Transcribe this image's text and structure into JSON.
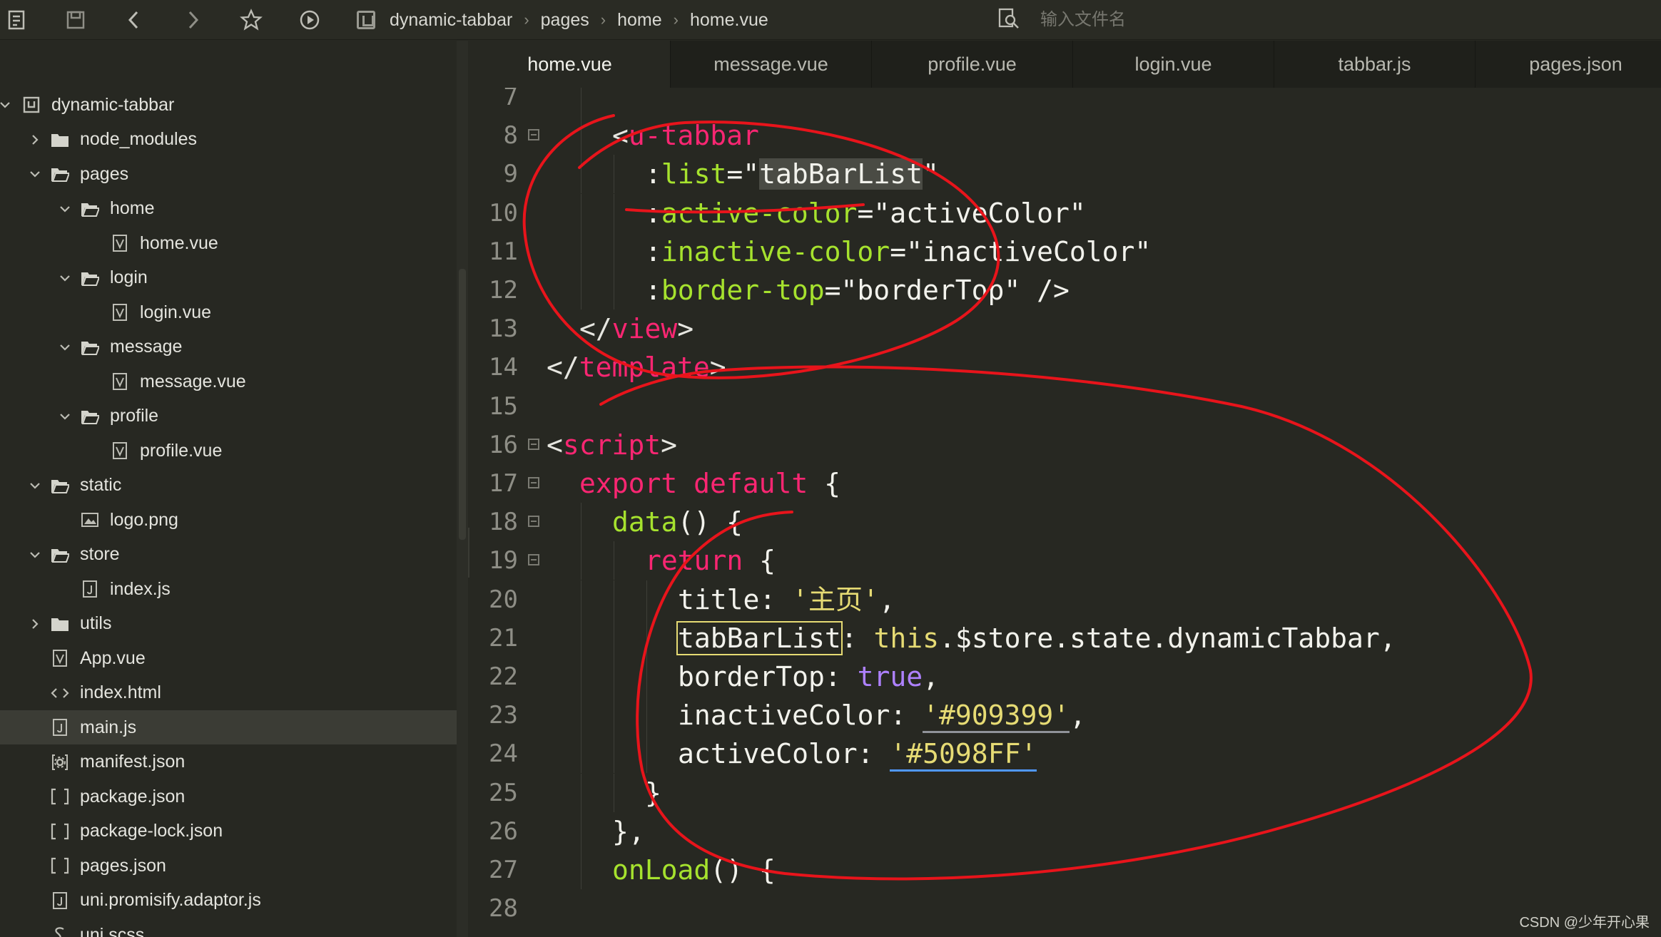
{
  "toolbar": {
    "icons": [
      "file-tree-icon",
      "save-icon",
      "back-icon",
      "forward-icon",
      "star-icon",
      "run-icon"
    ],
    "breadcrumb": [
      "dynamic-tabbar",
      "pages",
      "home",
      "home.vue"
    ],
    "search_placeholder": "输入文件名"
  },
  "sidebar": {
    "project": "dynamic-tabbar",
    "items": [
      {
        "label": "node_modules",
        "type": "folder",
        "depth": 1,
        "expanded": false
      },
      {
        "label": "pages",
        "type": "folder-open",
        "depth": 1,
        "expanded": true
      },
      {
        "label": "home",
        "type": "folder-open",
        "depth": 2,
        "expanded": true
      },
      {
        "label": "home.vue",
        "type": "vue",
        "depth": 3
      },
      {
        "label": "login",
        "type": "folder-open",
        "depth": 2,
        "expanded": true
      },
      {
        "label": "login.vue",
        "type": "vue",
        "depth": 3
      },
      {
        "label": "message",
        "type": "folder-open",
        "depth": 2,
        "expanded": true
      },
      {
        "label": "message.vue",
        "type": "vue",
        "depth": 3
      },
      {
        "label": "profile",
        "type": "folder-open",
        "depth": 2,
        "expanded": true
      },
      {
        "label": "profile.vue",
        "type": "vue",
        "depth": 3
      },
      {
        "label": "static",
        "type": "folder-open",
        "depth": 1,
        "expanded": true
      },
      {
        "label": "logo.png",
        "type": "image",
        "depth": 2
      },
      {
        "label": "store",
        "type": "folder-open",
        "depth": 1,
        "expanded": true
      },
      {
        "label": "index.js",
        "type": "js",
        "depth": 2
      },
      {
        "label": "utils",
        "type": "folder",
        "depth": 1,
        "expanded": false
      },
      {
        "label": "App.vue",
        "type": "vue",
        "depth": 1
      },
      {
        "label": "index.html",
        "type": "html",
        "depth": 1
      },
      {
        "label": "main.js",
        "type": "js",
        "depth": 1,
        "selected": true
      },
      {
        "label": "manifest.json",
        "type": "manifest",
        "depth": 1
      },
      {
        "label": "package.json",
        "type": "json",
        "depth": 1
      },
      {
        "label": "package-lock.json",
        "type": "json",
        "depth": 1
      },
      {
        "label": "pages.json",
        "type": "json",
        "depth": 1
      },
      {
        "label": "uni.promisify.adaptor.js",
        "type": "js",
        "depth": 1
      },
      {
        "label": "uni.scss",
        "type": "scss",
        "depth": 1
      }
    ]
  },
  "tabs": [
    "home.vue",
    "message.vue",
    "profile.vue",
    "login.vue",
    "tabbar.js",
    "pages.json"
  ],
  "active_tab": 0,
  "editor": {
    "lines": [
      {
        "n": "7",
        "fold": false,
        "indent": 2,
        "tokens": []
      },
      {
        "n": "8",
        "fold": true,
        "indent": 2,
        "tokens": [
          [
            "br",
            "<"
          ],
          [
            "tg",
            "u-tabbar"
          ]
        ]
      },
      {
        "n": "9",
        "fold": false,
        "indent": 3,
        "tokens": [
          [
            "pl",
            ":"
          ],
          [
            "at",
            "list"
          ],
          [
            "pl",
            "=\""
          ],
          [
            "sel",
            "tabBarList"
          ],
          [
            "pl",
            "\""
          ]
        ]
      },
      {
        "n": "10",
        "fold": false,
        "indent": 3,
        "tokens": [
          [
            "pl",
            ":"
          ],
          [
            "at",
            "active-color"
          ],
          [
            "pl",
            "=\"activeColor\""
          ]
        ]
      },
      {
        "n": "11",
        "fold": false,
        "indent": 3,
        "tokens": [
          [
            "pl",
            ":"
          ],
          [
            "at",
            "inactive-color"
          ],
          [
            "pl",
            "=\"inactiveColor\""
          ]
        ]
      },
      {
        "n": "12",
        "fold": false,
        "indent": 3,
        "tokens": [
          [
            "pl",
            ":"
          ],
          [
            "at",
            "border-top"
          ],
          [
            "pl",
            "=\"borderTop\" />"
          ]
        ]
      },
      {
        "n": "13",
        "fold": false,
        "indent": 1,
        "tokens": [
          [
            "br",
            "</"
          ],
          [
            "tg",
            "view"
          ],
          [
            "br",
            ">"
          ]
        ]
      },
      {
        "n": "14",
        "fold": false,
        "indent": 0,
        "tokens": [
          [
            "br",
            "</"
          ],
          [
            "tg",
            "template"
          ],
          [
            "br",
            ">"
          ]
        ]
      },
      {
        "n": "15",
        "fold": false,
        "indent": 0,
        "tokens": []
      },
      {
        "n": "16",
        "fold": true,
        "indent": 0,
        "tokens": [
          [
            "br",
            "<"
          ],
          [
            "tg",
            "script"
          ],
          [
            "br",
            ">"
          ]
        ]
      },
      {
        "n": "17",
        "fold": true,
        "indent": 1,
        "tokens": [
          [
            "kw",
            "export default"
          ],
          [
            "pl",
            " {"
          ]
        ]
      },
      {
        "n": "18",
        "fold": true,
        "indent": 2,
        "tokens": [
          [
            "fn",
            "data"
          ],
          [
            "pl",
            "() {"
          ]
        ]
      },
      {
        "n": "19",
        "fold": true,
        "indent": 3,
        "tokens": [
          [
            "kw",
            "return"
          ],
          [
            "pl",
            " {"
          ]
        ]
      },
      {
        "n": "20",
        "fold": false,
        "indent": 4,
        "tokens": [
          [
            "pl",
            "title: "
          ],
          [
            "st",
            "'主页'"
          ],
          [
            "pl",
            ","
          ]
        ]
      },
      {
        "n": "21",
        "fold": false,
        "indent": 4,
        "tokens": [
          [
            "box",
            "tabBarList"
          ],
          [
            "pl",
            ": "
          ],
          [
            "st",
            "this"
          ],
          [
            "pl",
            ".$store.state.dynamicTabbar,"
          ]
        ]
      },
      {
        "n": "22",
        "fold": false,
        "indent": 4,
        "tokens": [
          [
            "pl",
            "borderTop: "
          ],
          [
            "pu",
            "true"
          ],
          [
            "pl",
            ","
          ]
        ]
      },
      {
        "n": "23",
        "fold": false,
        "indent": 4,
        "tokens": [
          [
            "pl",
            "inactiveColor: "
          ],
          [
            "st",
            "'#909399'"
          ],
          [
            "pl",
            ","
          ]
        ]
      },
      {
        "n": "24",
        "fold": false,
        "indent": 4,
        "tokens": [
          [
            "pl",
            "activeColor: "
          ],
          [
            "st",
            "'#5098FF'"
          ]
        ]
      },
      {
        "n": "25",
        "fold": false,
        "indent": 3,
        "tokens": [
          [
            "pl",
            "}"
          ]
        ]
      },
      {
        "n": "26",
        "fold": false,
        "indent": 2,
        "tokens": [
          [
            "pl",
            "},"
          ]
        ]
      },
      {
        "n": "27",
        "fold": false,
        "indent": 2,
        "tokens": [
          [
            "fn",
            "onLoad"
          ],
          [
            "pl",
            "() {"
          ]
        ]
      },
      {
        "n": "28",
        "fold": false,
        "indent": 0,
        "tokens": []
      }
    ]
  },
  "colors": {
    "background": "#272822",
    "tag": "#f92672",
    "attribute": "#a6e22e",
    "string": "#e6db74",
    "boolean": "#ae81ff",
    "annotation": "#e8141b",
    "color_909399": "#909399",
    "color_5098FF": "#5098FF"
  },
  "watermark": "CSDN @少年开心果"
}
